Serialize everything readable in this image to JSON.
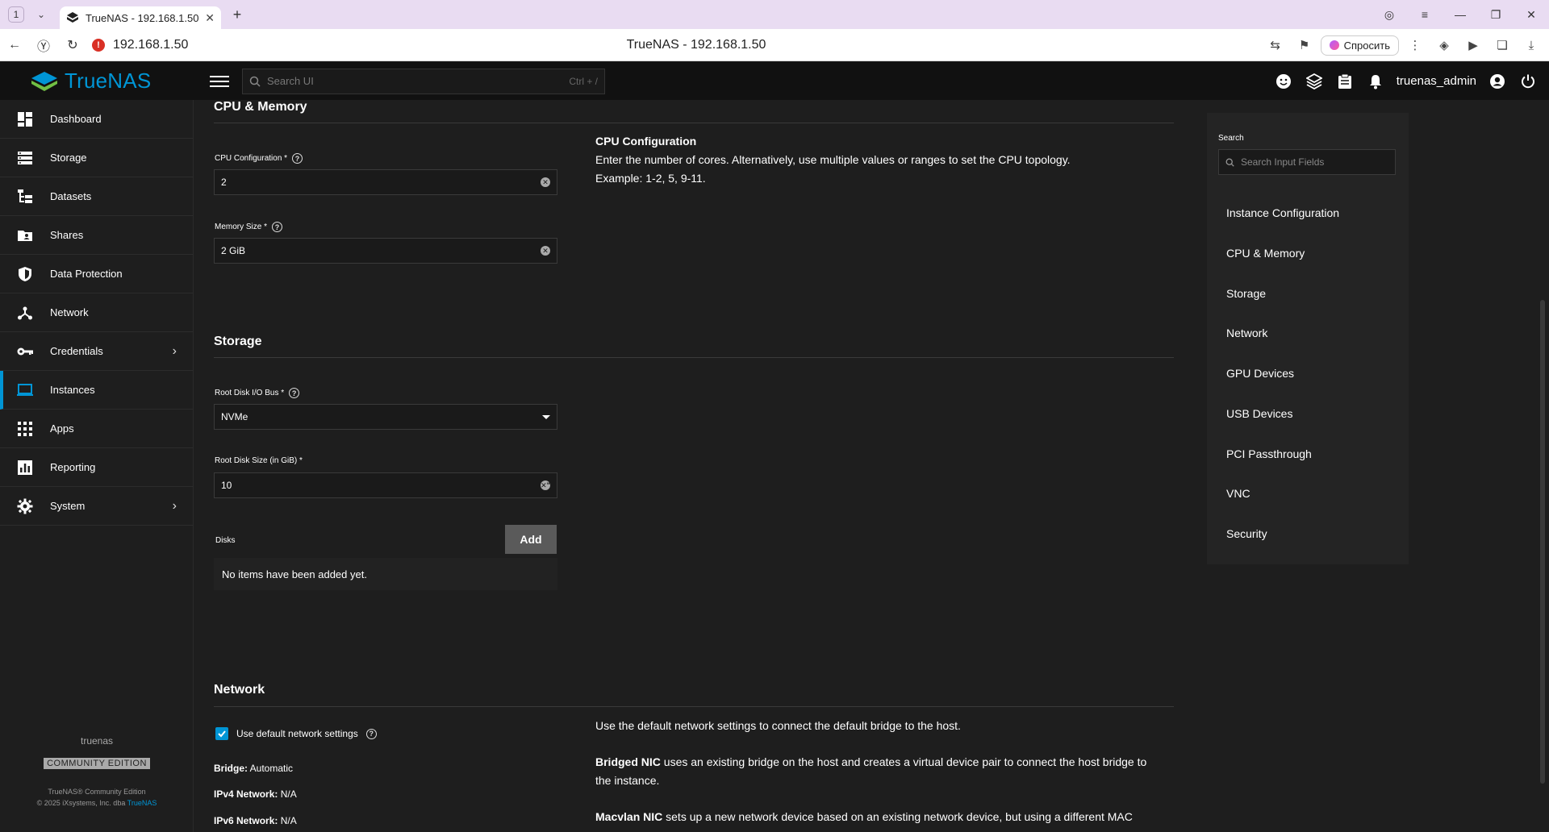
{
  "browser": {
    "tab_count": "1",
    "tab_title": "TrueNAS - 192.168.1.50",
    "url": "192.168.1.50",
    "page_title": "TrueNAS - 192.168.1.50",
    "ask_label": "Спросить"
  },
  "header": {
    "logo_text": "TrueNAS",
    "search_placeholder": "Search UI",
    "search_shortcut": "Ctrl + /",
    "username": "truenas_admin"
  },
  "sidebar": {
    "items": [
      {
        "label": "Dashboard",
        "icon": "dashboard-icon"
      },
      {
        "label": "Storage",
        "icon": "storage-icon"
      },
      {
        "label": "Datasets",
        "icon": "datasets-icon"
      },
      {
        "label": "Shares",
        "icon": "shares-icon"
      },
      {
        "label": "Data Protection",
        "icon": "shield-icon"
      },
      {
        "label": "Network",
        "icon": "network-icon"
      },
      {
        "label": "Credentials",
        "icon": "key-icon"
      },
      {
        "label": "Instances",
        "icon": "laptop-icon"
      },
      {
        "label": "Apps",
        "icon": "apps-grid-icon"
      },
      {
        "label": "Reporting",
        "icon": "chart-icon"
      },
      {
        "label": "System",
        "icon": "gear-icon"
      }
    ],
    "active": "Instances",
    "footer": {
      "hostname": "truenas",
      "edition": "COMMUNITY EDITION",
      "copyright1": "TrueNAS® Community Edition",
      "copyright2_prefix": "© 2025 iXsystems, Inc. dba ",
      "copyright2_brand": "TrueNAS"
    }
  },
  "cpu_memory": {
    "title": "CPU & Memory",
    "cpu_label": "CPU Configuration *",
    "cpu_value": "2",
    "memory_label": "Memory Size *",
    "memory_value": "2 GiB",
    "help_title": "CPU Configuration",
    "help_line1": "Enter the number of cores. Alternatively, use multiple values or ranges to set the CPU topology.",
    "help_line2": "Example: 1-2, 5, 9-11."
  },
  "storage": {
    "title": "Storage",
    "bus_label": "Root Disk I/O Bus *",
    "bus_value": "NVMe",
    "size_label": "Root Disk Size (in GiB) *",
    "size_value": "10",
    "disks_label": "Disks",
    "add_label": "Add",
    "empty_text": "No items have been added yet."
  },
  "network": {
    "title": "Network",
    "default_label": "Use default network settings",
    "bridge_key": "Bridge:",
    "bridge_val": "Automatic",
    "ipv4_key": "IPv4 Network:",
    "ipv4_val": "N/A",
    "ipv6_key": "IPv6 Network:",
    "ipv6_val": "N/A",
    "help1": "Use the default network settings to connect the default bridge to the host.",
    "help2_bold": "Bridged NIC",
    "help2_rest": " uses an existing bridge on the host and creates a virtual device pair to connect the host bridge to the instance.",
    "help3_bold": "Macvlan NIC",
    "help3_rest": " sets up a new network device based on an existing network device, but using a different MAC"
  },
  "right_nav": {
    "search_label": "Search",
    "search_placeholder": "Search Input Fields",
    "items": [
      "Instance Configuration",
      "CPU & Memory",
      "Storage",
      "Network",
      "GPU Devices",
      "USB Devices",
      "PCI Passthrough",
      "VNC",
      "Security"
    ]
  },
  "colors": {
    "accent": "#0095d5",
    "background": "#1e1e1e",
    "header": "#111111"
  }
}
